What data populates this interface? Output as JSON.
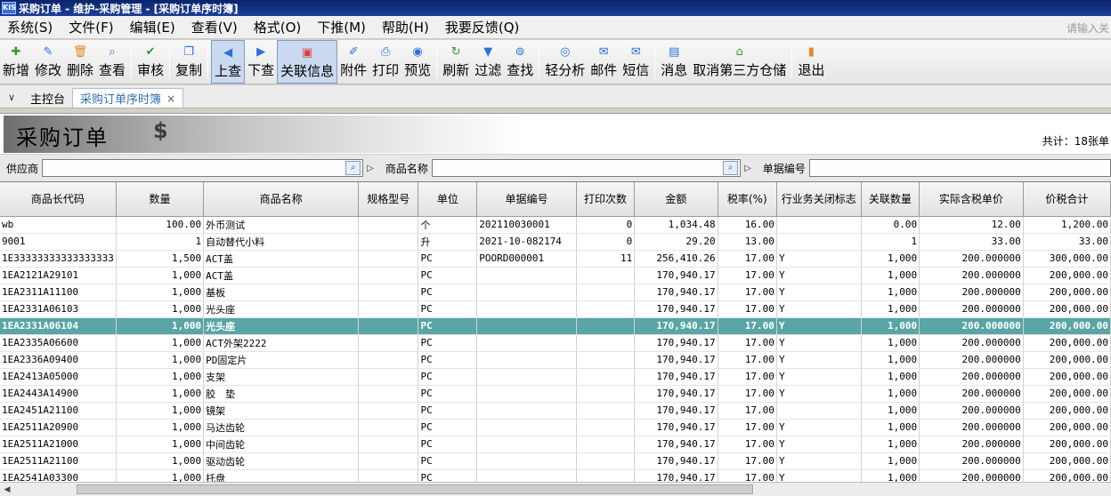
{
  "window": {
    "app_badge": "KIS",
    "title": "采购订单 - 维护-采购管理 - [采购订单序时簿]"
  },
  "menu": {
    "items": [
      "系统(S)",
      "文件(F)",
      "编辑(E)",
      "查看(V)",
      "格式(O)",
      "下推(M)",
      "帮助(H)",
      "我要反馈(Q)"
    ],
    "search_placeholder": "请输入关"
  },
  "toolbar": {
    "buttons": [
      {
        "label": "新增",
        "icon": "add-doc-icon",
        "color": "#2f9a3a",
        "glyph": "✚"
      },
      {
        "label": "修改",
        "icon": "edit-doc-icon",
        "color": "#2f6fd6",
        "glyph": "✎"
      },
      {
        "label": "删除",
        "icon": "trash-icon",
        "color": "#e08b2a",
        "glyph": "🗑"
      },
      {
        "label": "查看",
        "icon": "view-doc-icon",
        "color": "#2f6fd6",
        "glyph": "⌕"
      },
      {
        "label": "审核",
        "icon": "approve-icon",
        "color": "#2f9a3a",
        "glyph": "✔"
      },
      {
        "label": "复制",
        "icon": "copy-icon",
        "color": "#2f6fd6",
        "glyph": "❐"
      },
      {
        "label": "上查",
        "icon": "arrow-left-icon",
        "color": "#2f6fd6",
        "glyph": "◀"
      },
      {
        "label": "下查",
        "icon": "arrow-right-icon",
        "color": "#2f6fd6",
        "glyph": "▶"
      },
      {
        "label": "关联信息",
        "icon": "link-icon",
        "color": "#d64040",
        "glyph": "▣"
      },
      {
        "label": "附件",
        "icon": "paperclip-icon",
        "color": "#2f6fd6",
        "glyph": "✐"
      },
      {
        "label": "打印",
        "icon": "printer-icon",
        "color": "#2f6fd6",
        "glyph": "⎙"
      },
      {
        "label": "预览",
        "icon": "preview-icon",
        "color": "#2f6fd6",
        "glyph": "◉"
      },
      {
        "label": "刷新",
        "icon": "refresh-icon",
        "color": "#2f9a3a",
        "glyph": "↻"
      },
      {
        "label": "过滤",
        "icon": "filter-icon",
        "color": "#2f6fd6",
        "glyph": "▼"
      },
      {
        "label": "查找",
        "icon": "binoculars-icon",
        "color": "#2f6fd6",
        "glyph": "⊚"
      },
      {
        "label": "轻分析",
        "icon": "analysis-icon",
        "color": "#2f6fd6",
        "glyph": "◎"
      },
      {
        "label": "邮件",
        "icon": "mail-icon",
        "color": "#2f6fd6",
        "glyph": "✉"
      },
      {
        "label": "短信",
        "icon": "sms-icon",
        "color": "#2f6fd6",
        "glyph": "✉"
      },
      {
        "label": "消息",
        "icon": "message-icon",
        "color": "#2f6fd6",
        "glyph": "▤"
      },
      {
        "label": "取消第三方仓储",
        "icon": "warehouse-icon",
        "color": "#2f9a3a",
        "glyph": "⌂"
      },
      {
        "label": "退出",
        "icon": "exit-icon",
        "color": "#e08b2a",
        "glyph": "▮"
      }
    ]
  },
  "tabs": {
    "home": "主控台",
    "active": "采购订单序时簿",
    "close": "×"
  },
  "banner": {
    "title": "采购订单",
    "count": "共计：18张单"
  },
  "filters": {
    "supplier_label": "供应商",
    "product_label": "商品名称",
    "bill_label": "单据编号"
  },
  "grid": {
    "columns": [
      "商品长代码",
      "数量",
      "商品名称",
      "规格型号",
      "单位",
      "单据编号",
      "打印次数",
      "金额",
      "税率(%)",
      "行业务关闭标志",
      "关联数量",
      "实际含税单价",
      "价税合计"
    ],
    "selected_row": 6,
    "rows": [
      [
        "wb",
        "100.00",
        "外币测试",
        "",
        "个",
        "202110030001",
        "0",
        "1,034.48",
        "16.00",
        "",
        "0.00",
        "12.00",
        "1,200.00"
      ],
      [
        "9001",
        "1",
        "自动替代小料",
        "",
        "升",
        "2021-10-082174",
        "0",
        "29.20",
        "13.00",
        "",
        "1",
        "33.00",
        "33.00"
      ],
      [
        "1E33333333333333333",
        "1,500",
        "ACT盖",
        "",
        "PC",
        "POORD000001",
        "11",
        "256,410.26",
        "17.00",
        "Y",
        "1,000",
        "200.000000",
        "300,000.00"
      ],
      [
        "1EA2121A29101",
        "1,000",
        "ACT盖",
        "",
        "PC",
        "",
        "",
        "170,940.17",
        "17.00",
        "Y",
        "1,000",
        "200.000000",
        "200,000.00"
      ],
      [
        "1EA2311A11100",
        "1,000",
        "基板",
        "",
        "PC",
        "",
        "",
        "170,940.17",
        "17.00",
        "Y",
        "1,000",
        "200.000000",
        "200,000.00"
      ],
      [
        "1EA2331A06103",
        "1,000",
        "光头座",
        "",
        "PC",
        "",
        "",
        "170,940.17",
        "17.00",
        "Y",
        "1,000",
        "200.000000",
        "200,000.00"
      ],
      [
        "1EA2331A06104",
        "1,000",
        "光头座",
        "",
        "PC",
        "",
        "",
        "170,940.17",
        "17.00",
        "Y",
        "1,000",
        "200.000000",
        "200,000.00"
      ],
      [
        "1EA2335A06600",
        "1,000",
        "ACT外架2222",
        "",
        "PC",
        "",
        "",
        "170,940.17",
        "17.00",
        "Y",
        "1,000",
        "200.000000",
        "200,000.00"
      ],
      [
        "1EA2336A09400",
        "1,000",
        "PD固定片",
        "",
        "PC",
        "",
        "",
        "170,940.17",
        "17.00",
        "Y",
        "1,000",
        "200.000000",
        "200,000.00"
      ],
      [
        "1EA2413A05000",
        "1,000",
        "支架",
        "",
        "PC",
        "",
        "",
        "170,940.17",
        "17.00",
        "Y",
        "1,000",
        "200.000000",
        "200,000.00"
      ],
      [
        "1EA2443A14900",
        "1,000",
        "胶　垫",
        "",
        "PC",
        "",
        "",
        "170,940.17",
        "17.00",
        "Y",
        "1,000",
        "200.000000",
        "200,000.00"
      ],
      [
        "1EA2451A21100",
        "1,000",
        "镜架",
        "",
        "PC",
        "",
        "",
        "170,940.17",
        "17.00",
        "",
        "1,000",
        "200.000000",
        "200,000.00"
      ],
      [
        "1EA2511A20900",
        "1,000",
        "马达齿轮",
        "",
        "PC",
        "",
        "",
        "170,940.17",
        "17.00",
        "Y",
        "1,000",
        "200.000000",
        "200,000.00"
      ],
      [
        "1EA2511A21000",
        "1,000",
        "中间齿轮",
        "",
        "PC",
        "",
        "",
        "170,940.17",
        "17.00",
        "Y",
        "1,000",
        "200.000000",
        "200,000.00"
      ],
      [
        "1EA2511A21100",
        "1,000",
        "驱动齿轮",
        "",
        "PC",
        "",
        "",
        "170,940.17",
        "17.00",
        "Y",
        "1,000",
        "200.000000",
        "200,000.00"
      ],
      [
        "1EA2541A03300",
        "1,000",
        "托盘",
        "",
        "PC",
        "",
        "",
        "170,940.17",
        "17.00",
        "Y",
        "1,000",
        "200.000000",
        "200,000.00"
      ]
    ]
  }
}
